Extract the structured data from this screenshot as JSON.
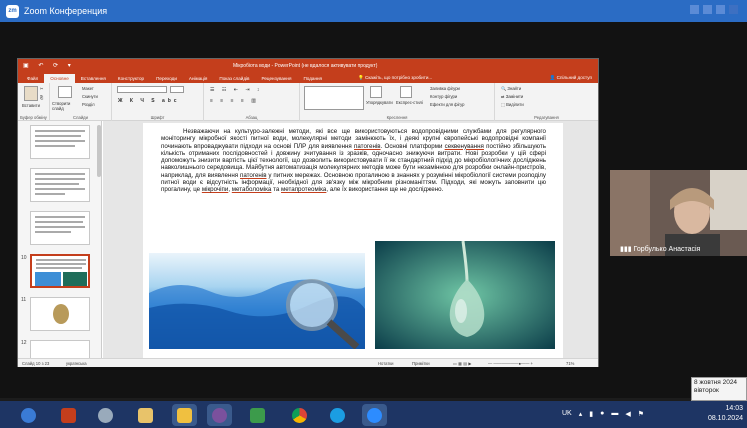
{
  "zoom": {
    "title": "Zoom Конференция"
  },
  "ppt": {
    "title": "Мікробіота води - PowerPoint (не вдалося активувати продукт)",
    "tabs": [
      "Файл",
      "Основне",
      "Вставлення",
      "Конструктор",
      "Переходи",
      "Анімація",
      "Показ слайдів",
      "Рецензування",
      "Подання"
    ],
    "active_tab": "Основне",
    "tell_me": "Скажіть, що потрібно зробити...",
    "share": "Спільний доступ",
    "ribbon": {
      "clipboard": {
        "label": "Буфер обміну",
        "paste": "Вставити",
        "cut": "",
        "copy": ""
      },
      "slides": {
        "label": "Слайди",
        "new_slide": "Створити слайд",
        "layout": "Макет",
        "reset": "Скинути",
        "section": "Розділ"
      },
      "font": {
        "label": "Шрифт"
      },
      "paragraph": {
        "label": "Абзац"
      },
      "drawing": {
        "label": "Креслення",
        "arrange": "Упорядкувати",
        "quick_styles": "Експрес-стилі",
        "fill": "Заливка фігури",
        "outline": "Контур фігури",
        "effects": "Ефекти для фігур"
      },
      "editing": {
        "label": "Редагування",
        "find": "Знайти",
        "replace": "Замінити",
        "select": "Виділити"
      }
    },
    "slide_numbers": [
      "",
      "",
      "",
      "10",
      "11",
      "12"
    ],
    "selected_slide": "10",
    "slide_text": {
      "p1": "Незважаючи на культуро-залежні методи, які все ще використовуються водопровідними службами для регулярного моніторингу мікробної якості питної води, молекулярні методи замінюють їх, і деякі крупні європейські водопровідні компанії починають впроваджувати підходи на основі ПЛР для виявлення ",
      "u1": "патогенів",
      "p2": ". Основні платформи ",
      "u2": "секвенування",
      "p3": " постійно збільшують кількість отриманих послідовностей і довжину зчитування із зразків, одночасно знижуючи витрати. Нові розробки у цій сфері допоможуть знизити вартість цієї технології, що дозволить використовувати її як стандартний підхід до мікробіологічних досліджень навколишнього середовища. Майбутня автоматизація молекулярних методів може бути незамінною для розробки онлайн-пристроїв, наприклад, для виявлення ",
      "u3": "патогенів",
      "p4": " у питних мережах. Основною прогалиною в знаннях у розумінні мікробіології системи розподілу питної води є відсутність інформації, необхідної для зв'язку між мікробним різноманіттям. Підходи, які можуть заповнити цю прогалину, це ",
      "u4": "мікрочіпи",
      "p5": ", ",
      "u5": "метаболоміка",
      "p6": " та ",
      "u6": "метапротеоміка",
      "p7": ", але їх використання ще не досліджено."
    },
    "status": {
      "slide_counter": "Слайд 10 з 23",
      "language": "українська",
      "notes": "Нотатки",
      "comments": "Примітки",
      "zoom": "71%"
    }
  },
  "participant": {
    "name": "Горбулько Анастасія"
  },
  "tooltip": {
    "date": "8 жовтня 2024",
    "day": "вівторок"
  },
  "tray": {
    "lang": "UK",
    "time": "14:03",
    "date": "08.10.2024"
  },
  "taskbar_items": [
    "start",
    "powerpoint",
    "search",
    "paint",
    "explorer",
    "viber",
    "camera",
    "chrome",
    "edge",
    "zoom"
  ],
  "colors": {
    "ppt_accent": "#c43e1c",
    "zoom_blue": "#2b6cc4",
    "taskbar": "#1e3564"
  }
}
